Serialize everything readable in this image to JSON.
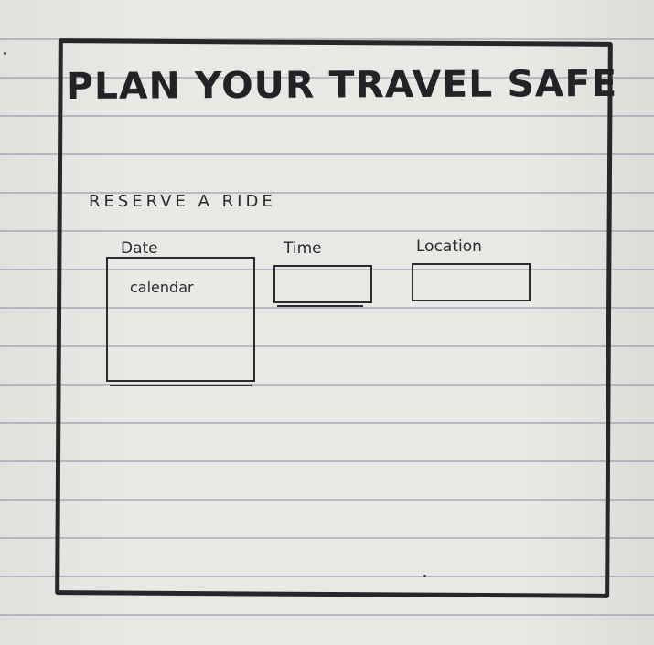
{
  "header": {
    "title": "PLAN YOUR TRAVEL SAFE"
  },
  "reservation": {
    "section_label": "RESERVE A RIDE",
    "date": {
      "label": "Date",
      "placeholder": "calendar"
    },
    "time": {
      "label": "Time",
      "value": ""
    },
    "location": {
      "label": "Location",
      "value": ""
    }
  },
  "colors": {
    "ink": "#26272b",
    "paper": "#e9e8e4",
    "paper_lines": "#b9bbc0"
  }
}
